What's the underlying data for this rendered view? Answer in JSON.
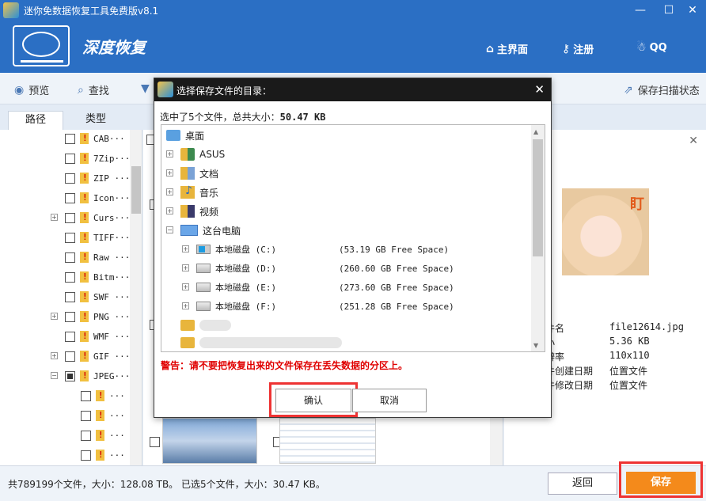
{
  "window": {
    "title": "迷你免数据恢复工具免费版v8.1",
    "min_icon": "minimize-icon",
    "close_icon": "close-icon"
  },
  "header": {
    "brand": "深度恢复",
    "nav": [
      {
        "label": "主界面",
        "icon": "home-icon"
      },
      {
        "label": "注册",
        "icon": "key-icon"
      },
      {
        "label": "QQ",
        "icon": "qq-icon"
      }
    ]
  },
  "toolbar": {
    "preview": "预览",
    "search": "查找",
    "save_scan": "保存扫描状态"
  },
  "tabs": [
    "路径",
    "类型"
  ],
  "tree": [
    {
      "label": "CAB···",
      "expand": false
    },
    {
      "label": "7Zip···",
      "expand": false
    },
    {
      "label": "ZIP ···",
      "expand": false
    },
    {
      "label": "Icon···",
      "expand": false
    },
    {
      "label": "Curs···",
      "expand": true
    },
    {
      "label": "TIFF···",
      "expand": false
    },
    {
      "label": "Raw ···",
      "expand": false
    },
    {
      "label": "Bitm···",
      "expand": false
    },
    {
      "label": "SWF ···",
      "expand": false
    },
    {
      "label": "PNG ···",
      "expand": true
    },
    {
      "label": "WMF ···",
      "expand": false
    },
    {
      "label": "GIF ···",
      "expand": true
    },
    {
      "label": "JPEG···",
      "expand": true
    }
  ],
  "tree_children": [
    "···",
    "···",
    "···",
    "···"
  ],
  "preview": {
    "avatar_text": "盯",
    "fields": [
      {
        "label": "件名",
        "value": "file12614.jpg"
      },
      {
        "label": "小",
        "value": "5.36 KB"
      },
      {
        "label": "辨率",
        "value": "110x110"
      },
      {
        "label": "件创建日期",
        "value": "位置文件"
      },
      {
        "label": "件修改日期",
        "value": "位置文件"
      }
    ]
  },
  "status": {
    "text": "共789199个文件，大小：128.08 TB。 已选5个文件，大小：30.47 KB。",
    "back": "返回",
    "save": "保存"
  },
  "dialog": {
    "title": "选择保存文件的目录：",
    "summary_prefix": "选中了5个文件，总共大小：",
    "summary_size": "50.47 KB",
    "root": "桌面",
    "folders": [
      "ASUS",
      "文档",
      "音乐",
      "视频",
      "这台电脑"
    ],
    "drives": [
      {
        "name": "本地磁盘 (C:)",
        "space": "(53.19 GB Free Space)"
      },
      {
        "name": "本地磁盘 (D:)",
        "space": "(260.60 GB Free Space)"
      },
      {
        "name": "本地磁盘 (E:)",
        "space": "(273.60 GB Free Space)"
      },
      {
        "name": "本地磁盘 (F:)",
        "space": "(251.28 GB Free Space)"
      }
    ],
    "warning": "警告：请不要把恢复出来的文件保存在丢失数据的分区上。",
    "ok": "确认",
    "cancel": "取消"
  }
}
